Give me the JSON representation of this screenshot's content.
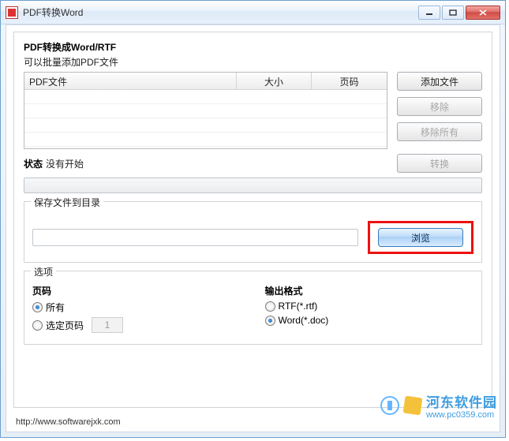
{
  "window": {
    "title": "PDF转换Word"
  },
  "main": {
    "title": "PDF转换成Word/RTF",
    "subtitle": "可以批量添加PDF文件"
  },
  "table": {
    "headers": {
      "file": "PDF文件",
      "size": "大小",
      "pages": "页码"
    },
    "rows": []
  },
  "buttons": {
    "add": "添加文件",
    "remove": "移除",
    "remove_all": "移除所有",
    "convert": "转换",
    "browse": "浏览"
  },
  "status": {
    "label": "状态",
    "value": "没有开始"
  },
  "save": {
    "legend": "保存文件到目录",
    "path": ""
  },
  "options": {
    "legend": "选项",
    "page": {
      "heading": "页码",
      "all": "所有",
      "selected": "选定页码",
      "selected_value": "1"
    },
    "format": {
      "heading": "输出格式",
      "rtf": "RTF(*.rtf)",
      "word": "Word(*.doc)"
    }
  },
  "watermark": {
    "name": "河东软件园",
    "url": "www.pc0359.com"
  },
  "footer": {
    "url": "http://www.softwarejxk.com"
  }
}
